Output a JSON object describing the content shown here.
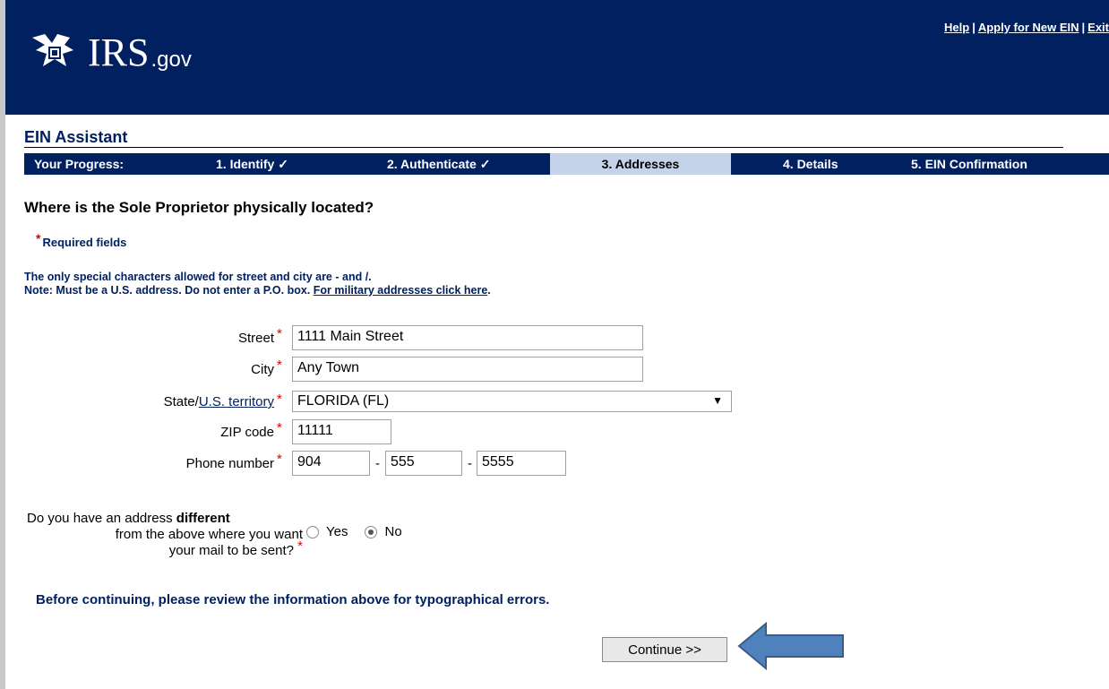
{
  "header": {
    "logo_text": "IRS",
    "logo_suffix": ".gov",
    "links": [
      "Help",
      "Apply for New EIN",
      "Exit"
    ],
    "bg_color": "#002060"
  },
  "assistant": {
    "title": "EIN Assistant"
  },
  "progress": {
    "label": "Your Progress:",
    "steps": [
      {
        "label": "1. Identify ✓",
        "status": "complete"
      },
      {
        "label": "2. Authenticate ✓",
        "status": "complete"
      },
      {
        "label": "3. Addresses",
        "status": "current"
      },
      {
        "label": "4. Details",
        "status": "pending"
      },
      {
        "label": "5. EIN Confirmation",
        "status": "pending"
      }
    ]
  },
  "question": "Where is the Sole Proprietor physically located?",
  "required_note": "Required fields",
  "notes": {
    "line1": "The only special characters allowed for street and city are - and /.",
    "line2_prefix": "Note: Must be a U.S. address. Do not enter a P.O. box. ",
    "line2_link": "For military addresses click here",
    "line2_suffix": "."
  },
  "form": {
    "street": {
      "label": "Street",
      "value": "1111 Main Street"
    },
    "city": {
      "label": "City",
      "value": "Any Town"
    },
    "state": {
      "label_prefix": "State/",
      "label_link": "U.S. territory",
      "value": "FLORIDA (FL)"
    },
    "zip": {
      "label": "ZIP code",
      "value": "11111"
    },
    "phone": {
      "label": "Phone number",
      "area": "904",
      "prefix": "555",
      "line": "5555",
      "separator": "-"
    }
  },
  "mail_question": {
    "line1_prefix": "Do you have an address ",
    "line1_bold": "different",
    "line2": "from the above where you want",
    "line3": "your mail to be sent?",
    "options": [
      "Yes",
      "No"
    ],
    "selected": "No"
  },
  "required_star": "*",
  "review_text": "Before continuing, please review the information above for typographical errors.",
  "continue_label": "Continue >>",
  "arrow_color": "#4f81bd"
}
